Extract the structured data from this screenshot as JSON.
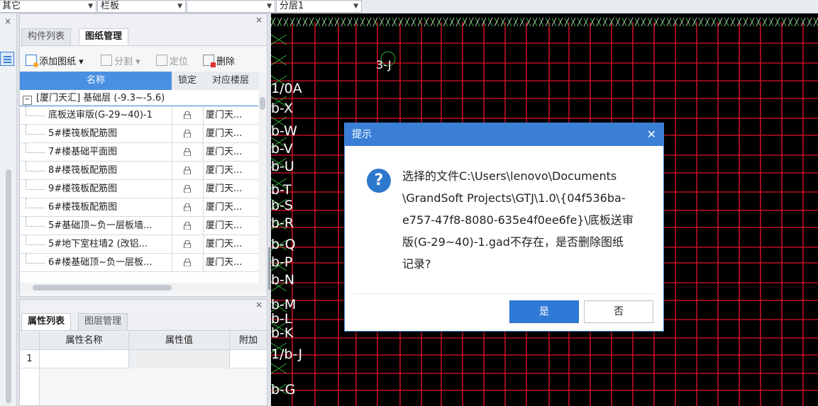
{
  "topbar": {
    "combo1": "其它",
    "combo2": "栏板",
    "combo3": "",
    "combo4": "分层1"
  },
  "drawing_panel": {
    "tabs": [
      "构件列表",
      "图纸管理"
    ],
    "toolbar": {
      "add": "添加图纸",
      "split": "分割",
      "locate": "定位",
      "delete": "删除"
    },
    "columns": [
      "名称",
      "锁定",
      "对应楼层"
    ],
    "group": "[厦门天汇] 基础层 (-9.3~-5.6)",
    "rows": [
      {
        "name": "底板送审版(G-29~40)-1",
        "floor": "厦门天..."
      },
      {
        "name": "5#楼筏板配筋图",
        "floor": "厦门天..."
      },
      {
        "name": "7#楼基础平面图",
        "floor": "厦门天..."
      },
      {
        "name": "8#楼筏板配筋图",
        "floor": "厦门天..."
      },
      {
        "name": "9#楼筏板配筋图",
        "floor": "厦门天..."
      },
      {
        "name": "6#楼筏板配筋图",
        "floor": "厦门天..."
      },
      {
        "name": "5#基础顶~负一层板墙...",
        "floor": "厦门天..."
      },
      {
        "name": "5#地下室柱墙2 (改铝...",
        "floor": "厦门天..."
      },
      {
        "name": "6#楼基础顶~负一层板...",
        "floor": "厦门天..."
      }
    ]
  },
  "property_panel": {
    "tabs": [
      "属性列表",
      "图层管理"
    ],
    "columns": [
      "属性名称",
      "属性值",
      "附加"
    ],
    "row_index": "1"
  },
  "cad": {
    "labels": [
      "1/0A",
      "b-X",
      "b-W",
      "b-V",
      "b-U",
      "b-T",
      "b-S",
      "b-R",
      "b-Q",
      "b-P",
      "b-N",
      "b-M",
      "b-L",
      "b-K",
      "1/b-J",
      "b-G",
      "3-J"
    ]
  },
  "dialog": {
    "title": "提示",
    "message": [
      "选择的文件C:\\Users\\lenovo\\Documents",
      "\\GrandSoft Projects\\GTJ\\1.0\\{04f536ba-",
      "e757-47f8-8080-635e4f0ee6fe}\\底板送审",
      "版(G-29~40)-1.gad不存在，是否删除图纸",
      "记录?"
    ],
    "yes": "是",
    "no": "否"
  },
  "colors": {
    "accent": "#3a7fd5",
    "grid_header": "#4a90e2",
    "cad_bg": "#000000",
    "cad_red": "#e0102a",
    "cad_green": "#2fae3a"
  }
}
